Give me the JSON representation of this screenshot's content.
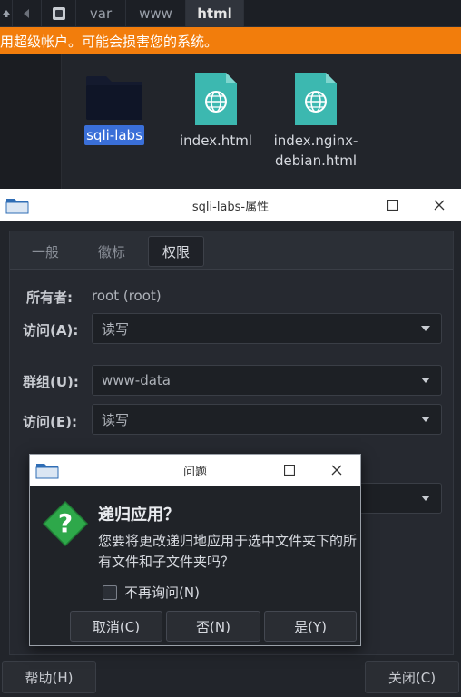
{
  "pathbar": {
    "segments": [
      "var",
      "www",
      "html"
    ]
  },
  "warning": {
    "text": "用超级帐户。可能会损害您的系统。"
  },
  "files": [
    {
      "label": "sqli-labs",
      "icon": "folder-icon",
      "selected": true
    },
    {
      "label": "index.html",
      "icon": "html-file-icon"
    },
    {
      "label_line1": "index.nginx-",
      "label_line2": "debian.html",
      "icon": "html-file-icon"
    }
  ],
  "properties": {
    "title": "sqli-labs-属性",
    "tabs": [
      "一般",
      "徽标",
      "权限"
    ],
    "owner_label": "所有者:",
    "owner_value": "root (root)",
    "access_label": "访问(A):",
    "access_value": "读写",
    "group_label": "群组(U):",
    "group_value": "www-data",
    "group_access_label": "访问(E):",
    "group_access_value": "读写",
    "help_button": "帮助(H)",
    "close_button": "关闭(C)"
  },
  "question": {
    "title": "问题",
    "heading": "递归应用？",
    "message": "您要将更改递归地应用于选中文件夹下的所有文件和子文件夹吗？",
    "checkbox_label": "不再询问(N)",
    "cancel_button": "取消(C)",
    "no_button": "否(N)",
    "yes_button": "是(Y)"
  },
  "colors": {
    "warning": "#f27d0c",
    "accent": "#3a6fd8",
    "file_icon": "#3cb8b0",
    "question_icon": "#2ea84a"
  }
}
